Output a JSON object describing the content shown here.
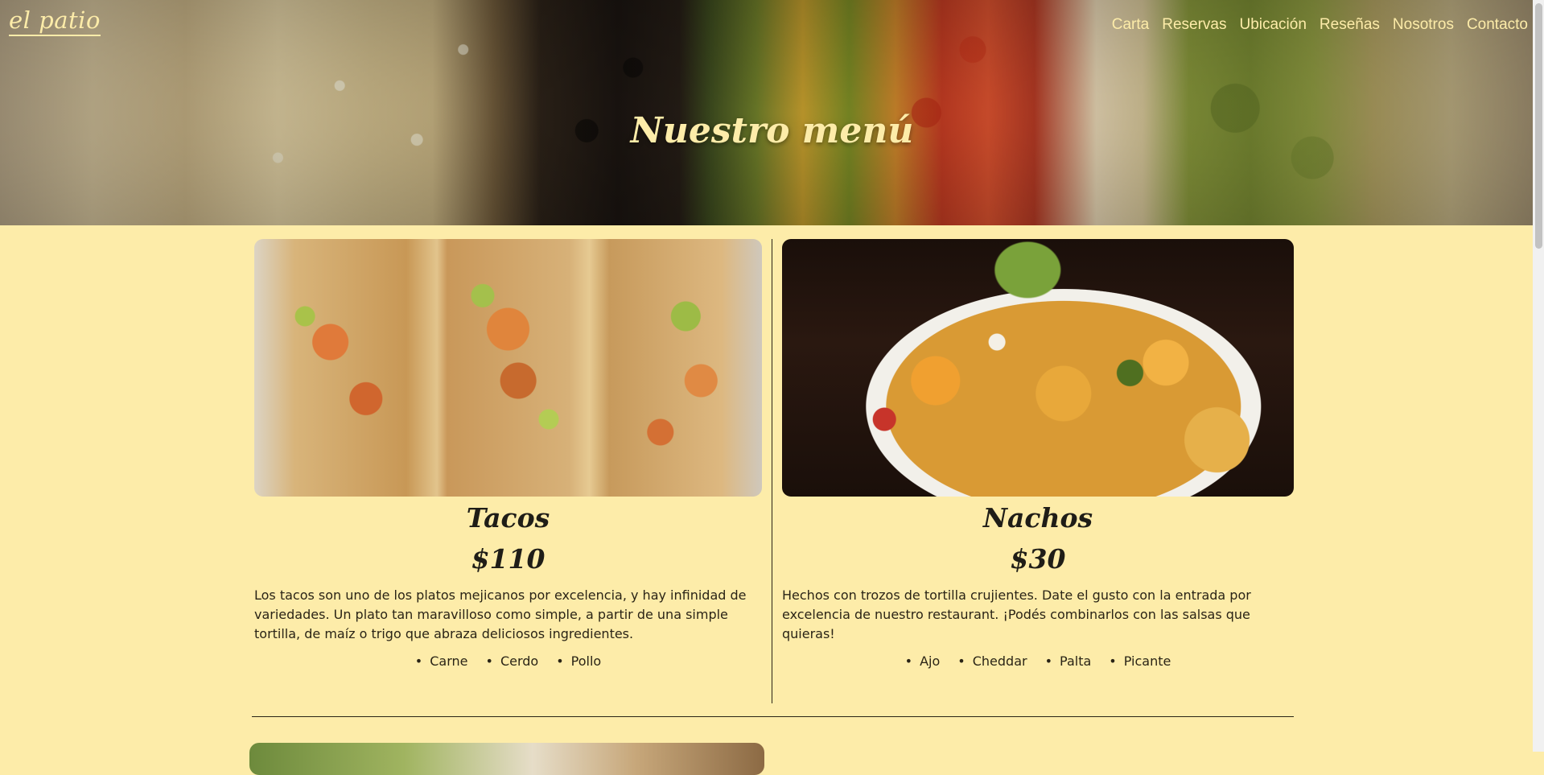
{
  "brand": "el patio",
  "nav": [
    "Carta",
    "Reservas",
    "Ubicación",
    "Reseñas",
    "Nosotros",
    "Contacto"
  ],
  "hero_title": "Nuestro menú",
  "dishes": [
    {
      "name": "Tacos",
      "price": "$110",
      "description": "Los tacos son uno de los platos mejicanos por excelencia, y hay infinidad de variedades. Un plato tan maravilloso como simple, a partir de una simple tortilla, de maíz o trigo que abraza deliciosos ingredientes.",
      "options": [
        "Carne",
        "Cerdo",
        "Pollo"
      ]
    },
    {
      "name": "Nachos",
      "price": "$30",
      "description": "Hechos con trozos de tortilla crujientes. Date el gusto con la entrada por excelencia de nuestro restaurant. ¡Podés combinarlos con las salsas que quieras!",
      "options": [
        "Ajo",
        "Cheddar",
        "Palta",
        "Picante"
      ]
    }
  ],
  "colors": {
    "background": "#fdeca9",
    "accent_text": "#fdeca9",
    "body_text": "#2a2416"
  }
}
